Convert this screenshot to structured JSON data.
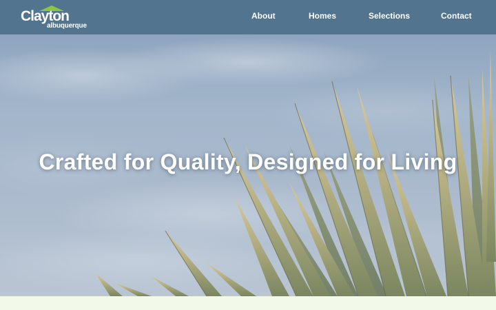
{
  "brand": {
    "name": "Clayton",
    "location": "albuquerque",
    "roof_color": "#8cc63f"
  },
  "nav": {
    "items": [
      {
        "label": "About"
      },
      {
        "label": "Homes"
      },
      {
        "label": "Selections"
      },
      {
        "label": "Contact"
      }
    ]
  },
  "hero": {
    "title": "Crafted for Quality, Designed for Living"
  },
  "colors": {
    "header_bg": "#52748f",
    "band_bg": "#f3f9e9"
  }
}
